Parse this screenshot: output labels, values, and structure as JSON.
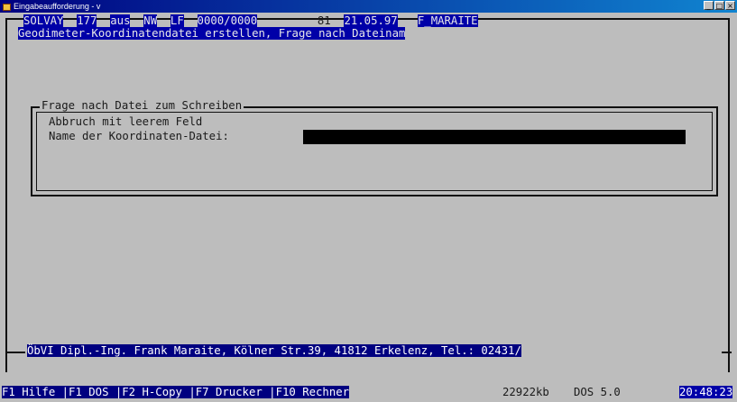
{
  "window": {
    "title": "Eingabeaufforderung - v",
    "icon": "dos-window-icon",
    "buttons": [
      "_",
      "□",
      "×"
    ]
  },
  "status_line": {
    "items": [
      "SOLVAY",
      "177",
      "aus",
      "NW",
      "LF",
      "0000/0000",
      "81",
      "21.05.97",
      "F_MARAITE"
    ]
  },
  "header_title": "Geodimeter-Koordinatendatei erstellen, Frage nach Dateinam",
  "dialog": {
    "title": "Frage nach Datei zum Schreiben",
    "hint": "Abbruch mit leerem Feld",
    "label": "Name der Koordinaten-Datei:",
    "input_value": ""
  },
  "footer_info": "ÖbVI Dipl.-Ing. Frank Maraite, Kölner Str.39, 41812 Erkelenz, Tel.: 02431/",
  "function_keys": [
    "F1 Hilfe",
    "F1 DOS",
    "F2 H-Copy",
    "F7 Drucker",
    "F10 Rechner"
  ],
  "system": {
    "memory": "22922kb",
    "dos_version": "DOS 5.0",
    "time": "20:48:23"
  }
}
